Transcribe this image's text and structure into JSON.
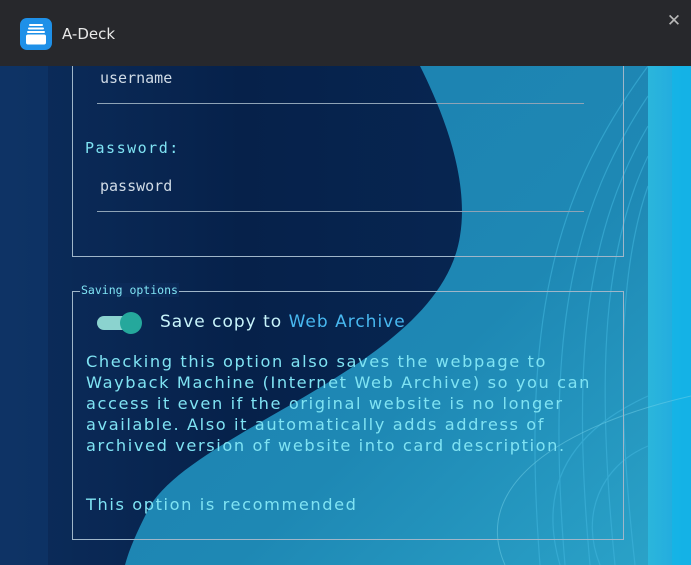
{
  "window": {
    "title": "A-Deck",
    "close_glyph": "✕",
    "icon": "card-stack-icon"
  },
  "login": {
    "username_value": "username",
    "password_label": "Password:",
    "password_value": "password"
  },
  "saving": {
    "legend": "Saving options",
    "toggle_on": true,
    "toggle_label_prefix": "Save copy to ",
    "toggle_label_link": "Web Archive",
    "description": "Checking this option also saves the webpage to Wayback Machine (Internet Web Archive) so you can access it even if the original website is no longer available. Also it automatically adds address of archived version of website into card description.",
    "recommendation": "This option is recommended"
  },
  "colors": {
    "titlebar": "#27282c",
    "accent_text": "#7fe3f3",
    "link": "#48b8f0",
    "toggle_knob": "#25a89c",
    "toggle_track": "#8bd3cf"
  }
}
